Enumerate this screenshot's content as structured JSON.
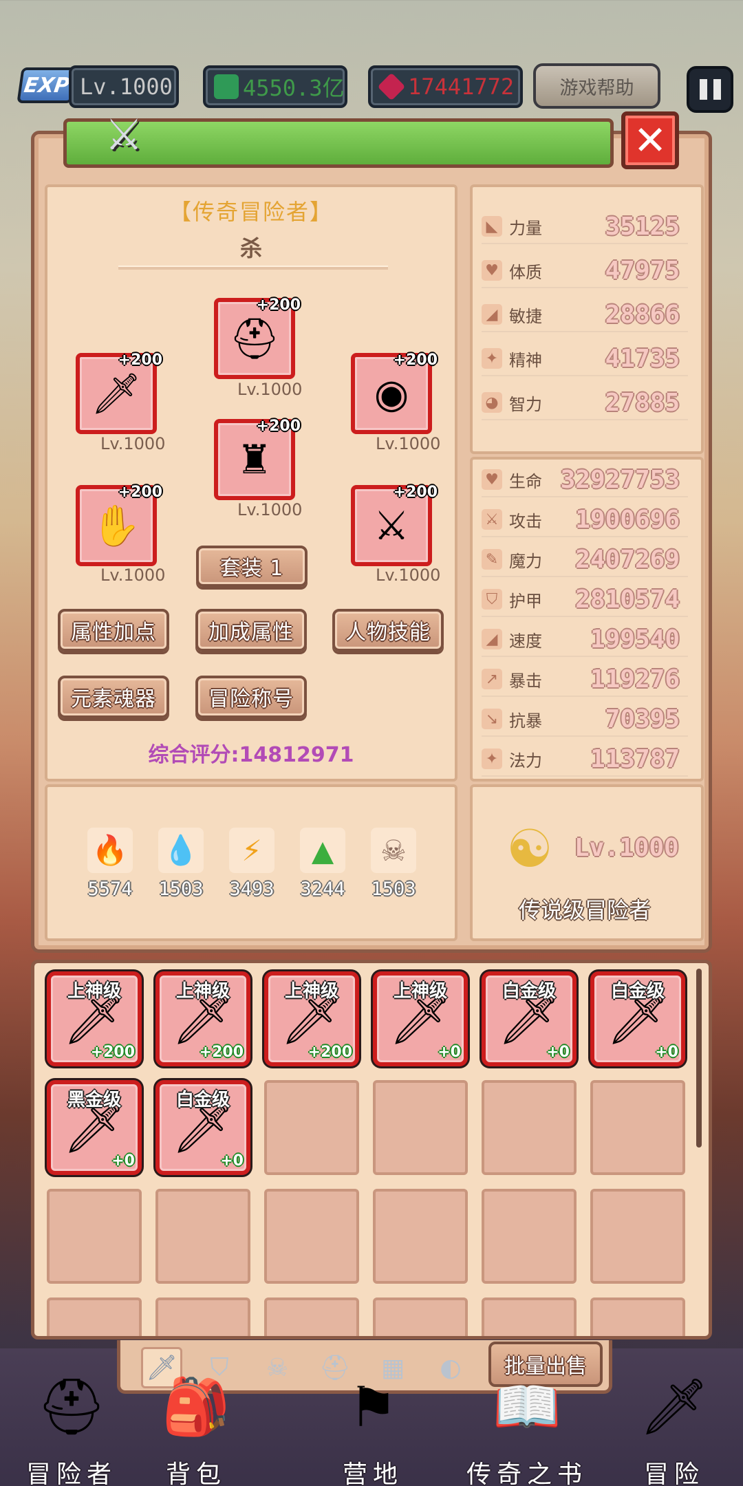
{
  "topbar": {
    "exp_badge": "EXP",
    "level": "Lv.1000",
    "green_currency": "4550.3亿",
    "red_currency": "17441772",
    "help_label": "游戏帮助",
    "colors": {
      "green_currency": "#3f9a4a",
      "red_currency": "#c8323a"
    }
  },
  "panel": {
    "close_label": "✕",
    "hero_title": "【传奇冒险者】",
    "hero_name": "杀",
    "equipment": [
      {
        "slot": "helmet",
        "icon": "helmet-icon",
        "glyph": "⛑",
        "plus": "+200",
        "level": "Lv.1000"
      },
      {
        "slot": "weapon",
        "icon": "flame-sword-icon",
        "glyph": "🗡",
        "plus": "+200",
        "level": "Lv.1000"
      },
      {
        "slot": "shield",
        "icon": "round-shield-icon",
        "glyph": "◉",
        "plus": "+200",
        "level": "Lv.1000"
      },
      {
        "slot": "armor",
        "icon": "chest-armor-icon",
        "glyph": "♜",
        "plus": "+200",
        "level": "Lv.1000"
      },
      {
        "slot": "gloves",
        "icon": "gauntlet-icon",
        "glyph": "✋",
        "plus": "+200",
        "level": "Lv.1000"
      },
      {
        "slot": "legs",
        "icon": "leg-armor-icon",
        "glyph": "⚔",
        "plus": "+200",
        "level": "Lv.1000"
      }
    ],
    "set_label": "套装 1",
    "buttons": [
      "属性加点",
      "加成属性",
      "人物技能",
      "元素魂器",
      "冒险称号"
    ],
    "score_label": "综合评分:14812971",
    "elements": [
      {
        "icon": "fire-element-icon",
        "glyph": "🔥",
        "value": "5574",
        "color": "#e5412a"
      },
      {
        "icon": "water-element-icon",
        "glyph": "💧",
        "value": "1503",
        "color": "#3a8fe0"
      },
      {
        "icon": "lightning-element-icon",
        "glyph": "⚡",
        "value": "3493",
        "color": "#f0a21c"
      },
      {
        "icon": "earth-element-icon",
        "glyph": "▲",
        "value": "3244",
        "color": "#3cae3e"
      },
      {
        "icon": "dark-element-icon",
        "glyph": "☠",
        "value": "1503",
        "color": "#8a6a5c"
      }
    ],
    "base_stats": [
      {
        "label": "力量",
        "value": "35125",
        "icon": "strength-icon",
        "glyph": "◣"
      },
      {
        "label": "体质",
        "value": "47975",
        "icon": "heart-icon",
        "glyph": "♥"
      },
      {
        "label": "敏捷",
        "value": "28866",
        "icon": "boot-icon",
        "glyph": "◢"
      },
      {
        "label": "精神",
        "value": "41735",
        "icon": "star-icon",
        "glyph": "✦"
      },
      {
        "label": "智力",
        "value": "27885",
        "icon": "brain-icon",
        "glyph": "◕"
      }
    ],
    "combat_stats": [
      {
        "label": "生命",
        "value": "32927753",
        "icon": "heart-icon",
        "glyph": "♥"
      },
      {
        "label": "攻击",
        "value": "1900696",
        "icon": "sword-icon",
        "glyph": "⚔"
      },
      {
        "label": "魔力",
        "value": "2407269",
        "icon": "wand-icon",
        "glyph": "✎"
      },
      {
        "label": "护甲",
        "value": "2810574",
        "icon": "shield-icon",
        "glyph": "⛉"
      },
      {
        "label": "速度",
        "value": "199540",
        "icon": "boot-icon",
        "glyph": "◢"
      },
      {
        "label": "暴击",
        "value": "119276",
        "icon": "crit-icon",
        "glyph": "↗"
      },
      {
        "label": "抗暴",
        "value": "70395",
        "icon": "anti-crit-icon",
        "glyph": "↘"
      },
      {
        "label": "法力",
        "value": "113787",
        "icon": "mana-icon",
        "glyph": "✦"
      }
    ],
    "rank_level": "Lv.1000",
    "rank_title": "传说级冒险者"
  },
  "inventory": {
    "items": [
      {
        "grade": "上神级",
        "plus": "+200"
      },
      {
        "grade": "上神级",
        "plus": "+200"
      },
      {
        "grade": "上神级",
        "plus": "+200"
      },
      {
        "grade": "上神级",
        "plus": "+0"
      },
      {
        "grade": "白金级",
        "plus": "+0"
      },
      {
        "grade": "白金级",
        "plus": "+0"
      },
      {
        "grade": "黑金级",
        "plus": "+0"
      },
      {
        "grade": "白金级",
        "plus": "+0"
      }
    ],
    "item_glyph": "🗡",
    "tabs": [
      {
        "icon": "weapon-tab-icon",
        "glyph": "🗡",
        "active": true
      },
      {
        "icon": "armor-tab-icon",
        "glyph": "⛉",
        "active": false
      },
      {
        "icon": "skull-tab-icon",
        "glyph": "☠",
        "active": false
      },
      {
        "icon": "helmet-tab-icon",
        "glyph": "⛑",
        "active": false
      },
      {
        "icon": "chest-tab-icon",
        "glyph": "▦",
        "active": false
      },
      {
        "icon": "ring-tab-icon",
        "glyph": "◐",
        "active": false
      }
    ],
    "bulk_sell_label": "批量出售"
  },
  "bottom_nav": [
    {
      "label": "冒险者",
      "icon": "adventurer-helmet-icon",
      "glyph": "⛑"
    },
    {
      "label": "背包",
      "icon": "backpack-icon",
      "glyph": "🎒"
    },
    {
      "label": "营地",
      "icon": "camp-banner-icon",
      "glyph": "⚑"
    },
    {
      "label": "传奇之书",
      "icon": "legend-book-icon",
      "glyph": "📖"
    },
    {
      "label": "冒险",
      "icon": "adventure-sword-icon",
      "glyph": "🗡"
    }
  ]
}
